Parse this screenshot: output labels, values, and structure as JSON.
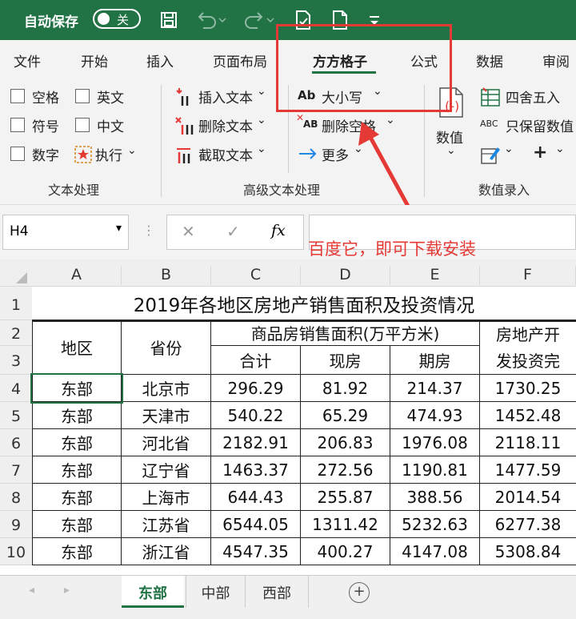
{
  "titlebar": {
    "autosave_label": "自动保存",
    "autosave_state": "关"
  },
  "menu": {
    "items": [
      "文件",
      "开始",
      "插入",
      "页面布局",
      "方方格子",
      "公式",
      "数据",
      "审阅"
    ],
    "active": "方方格子"
  },
  "ribbon": {
    "text_group": {
      "checkboxes": [
        "空格",
        "英文",
        "符号",
        "中文",
        "数字"
      ],
      "execute_label": "执行",
      "group_label": "文本处理"
    },
    "advanced_group": {
      "insert_text": "插入文本",
      "delete_text": "删除文本",
      "extract_text": "截取文本",
      "case_label": "大小写",
      "case_icon_text": "Ab",
      "delete_space": "删除空格",
      "delete_space_icon_text": "AB",
      "more": "更多",
      "group_label": "高级文本处理"
    },
    "numeric_group": {
      "numeric_label": "数值",
      "round_label": "四舍五入",
      "keep_numeric_label": "只保留数值",
      "keep_icon_text": "ABC",
      "plus": "+",
      "group_label": "数值录入"
    }
  },
  "annotation": "百度它，即可下载安装",
  "formula": {
    "cell_ref": "H4",
    "fx": "fx",
    "value": ""
  },
  "sheet": {
    "columns": [
      "A",
      "B",
      "C",
      "D",
      "E",
      "F"
    ],
    "rows": [
      "1",
      "2",
      "3",
      "4",
      "5",
      "6",
      "7",
      "8",
      "9",
      "10"
    ],
    "title": "2019年各地区房地产销售面积及投资情况",
    "header": {
      "region": "地区",
      "province": "省份",
      "sales_area": "商品房销售面积(万平方米)",
      "total": "合计",
      "existing": "现房",
      "presale": "期房",
      "investment_line1": "房地产开",
      "investment_line2": "发投资完"
    },
    "data": [
      [
        "东部",
        "北京市",
        "296.29",
        "81.92",
        "214.37",
        "1730.25"
      ],
      [
        "东部",
        "天津市",
        "540.22",
        "65.29",
        "474.93",
        "1452.48"
      ],
      [
        "东部",
        "河北省",
        "2182.91",
        "206.83",
        "1976.08",
        "2118.11"
      ],
      [
        "东部",
        "辽宁省",
        "1463.37",
        "272.56",
        "1190.81",
        "1477.59"
      ],
      [
        "东部",
        "上海市",
        "644.43",
        "255.87",
        "388.56",
        "2014.54"
      ],
      [
        "东部",
        "江苏省",
        "6544.05",
        "1311.42",
        "5232.63",
        "6277.38"
      ],
      [
        "东部",
        "浙江省",
        "4547.35",
        "400.27",
        "4147.08",
        "5308.84"
      ]
    ]
  },
  "tabs": {
    "items": [
      "东部",
      "中部",
      "西部"
    ],
    "active": "东部",
    "add": "+"
  }
}
